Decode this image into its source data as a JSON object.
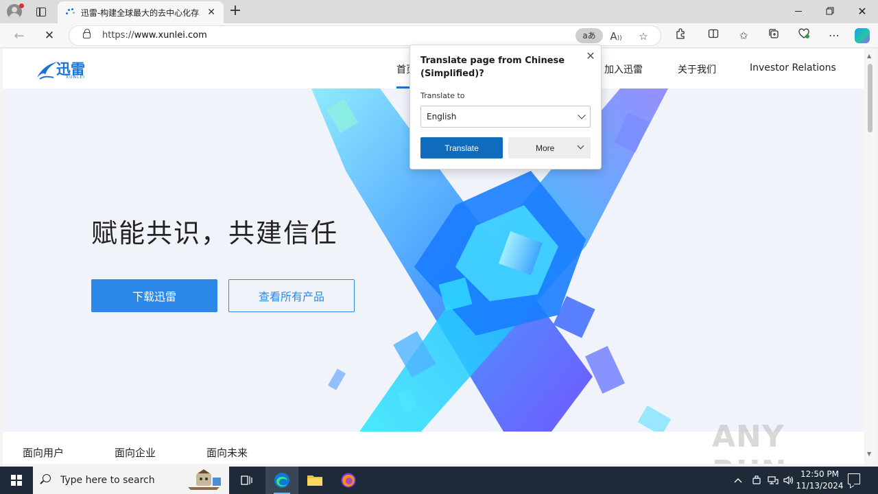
{
  "browser": {
    "tab_title": "迅雷-构建全球最大的去中心化存",
    "url_prefix": "https://",
    "url_host": "www.xunlei.com",
    "translate_chip": "aあ"
  },
  "site": {
    "logo_text": "迅雷",
    "logo_sub": "XUNLEI",
    "nav": {
      "home": "首页",
      "join": "加入迅雷",
      "about": "关于我们",
      "investor": "Investor Relations"
    },
    "hero_title": "赋能共识，共建信任",
    "download_btn": "下载迅雷",
    "products_btn": "查看所有产品",
    "bottom_tabs": [
      "面向用户",
      "面向企业",
      "面向未来"
    ]
  },
  "translate_popup": {
    "title": "Translate page from Chinese (Simplified)?",
    "translate_to_label": "Translate to",
    "selected_language": "English",
    "translate_btn": "Translate",
    "more_btn": "More"
  },
  "watermark": "ANY RUN",
  "taskbar": {
    "search_placeholder": "Type here to search",
    "time": "12:50 PM",
    "date": "11/13/2024"
  },
  "colors": {
    "brand_blue": "#2b87e8",
    "translate_blue": "#0f6cbd",
    "taskbar": "#1f2a38"
  }
}
